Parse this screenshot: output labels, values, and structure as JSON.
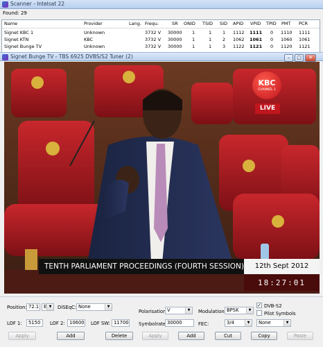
{
  "scanner": {
    "title": "Scanner - Intelsat 22",
    "found": "Found: 29",
    "columns": [
      "Name",
      "Provider",
      "Lang.",
      "Frequ.",
      "SR",
      "ONID",
      "TSID",
      "SID",
      "APID",
      "VPID",
      "TPID",
      "PMT",
      "PCR"
    ],
    "rows": [
      [
        "Signet KBC 1",
        "Unknown",
        "",
        "3732 V",
        "30000",
        "1",
        "1",
        "1",
        "1112",
        "1111",
        "0",
        "1110",
        "1111"
      ],
      [
        "Signet KTN",
        "KBC",
        "",
        "3732 V",
        "30000",
        "1",
        "1",
        "2",
        "1062",
        "1061",
        "0",
        "1060",
        "1061"
      ],
      [
        "Signet Bunge TV",
        "Unknown",
        "",
        "3732 V",
        "30000",
        "1",
        "1",
        "3",
        "1122",
        "1121",
        "0",
        "1120",
        "1121"
      ]
    ]
  },
  "tv": {
    "title": "Signet Bunge TV - TBS 6925 DVBS/S2 Tuner (2)",
    "buttons": {
      "min": "–",
      "max": "□",
      "close": "✕"
    },
    "logo": "KBC",
    "logo_sub": "CHANNEL 1",
    "live": "LIVE",
    "ticker": "TENTH PARLIAMENT PROCEEDINGS (FOURTH SESSION)",
    "date": "12th Sept 2012",
    "clock": "18:27:01"
  },
  "controls": {
    "position_label": "Position:",
    "position_value": "72.1",
    "position_dir": "E",
    "diseqc_label": "DiSEqC:",
    "diseqc_value": "None",
    "polarisation_label": "Polarisation:",
    "polarisation_value": "V",
    "modulation_label": "Modulation:",
    "modulation_value": "BPSK",
    "dvbs2_label": "DVB-S2",
    "dvbs2_checked": true,
    "pilot_label": "Pilot Symbols",
    "pilot_checked": false,
    "lof1_label": "LOF 1:",
    "lof1_value": "5150",
    "lof2_label": "LOF 2:",
    "lof2_value": "10600",
    "lofsw_label": "LOF SW:",
    "lofsw_value": "11700",
    "symbolrate_label": "Symbolrate:",
    "symbolrate_value": "30000",
    "fec_label": "FEC:",
    "fec_value": "3/4",
    "extra_value": "None",
    "btn_apply_left": "Apply",
    "btn_add_left": "Add",
    "btn_delete": "Delete",
    "btn_apply_mid": "Apply",
    "btn_add_mid": "Add",
    "btn_cut": "Cut",
    "btn_copy": "Copy",
    "btn_paste": "Paste"
  }
}
